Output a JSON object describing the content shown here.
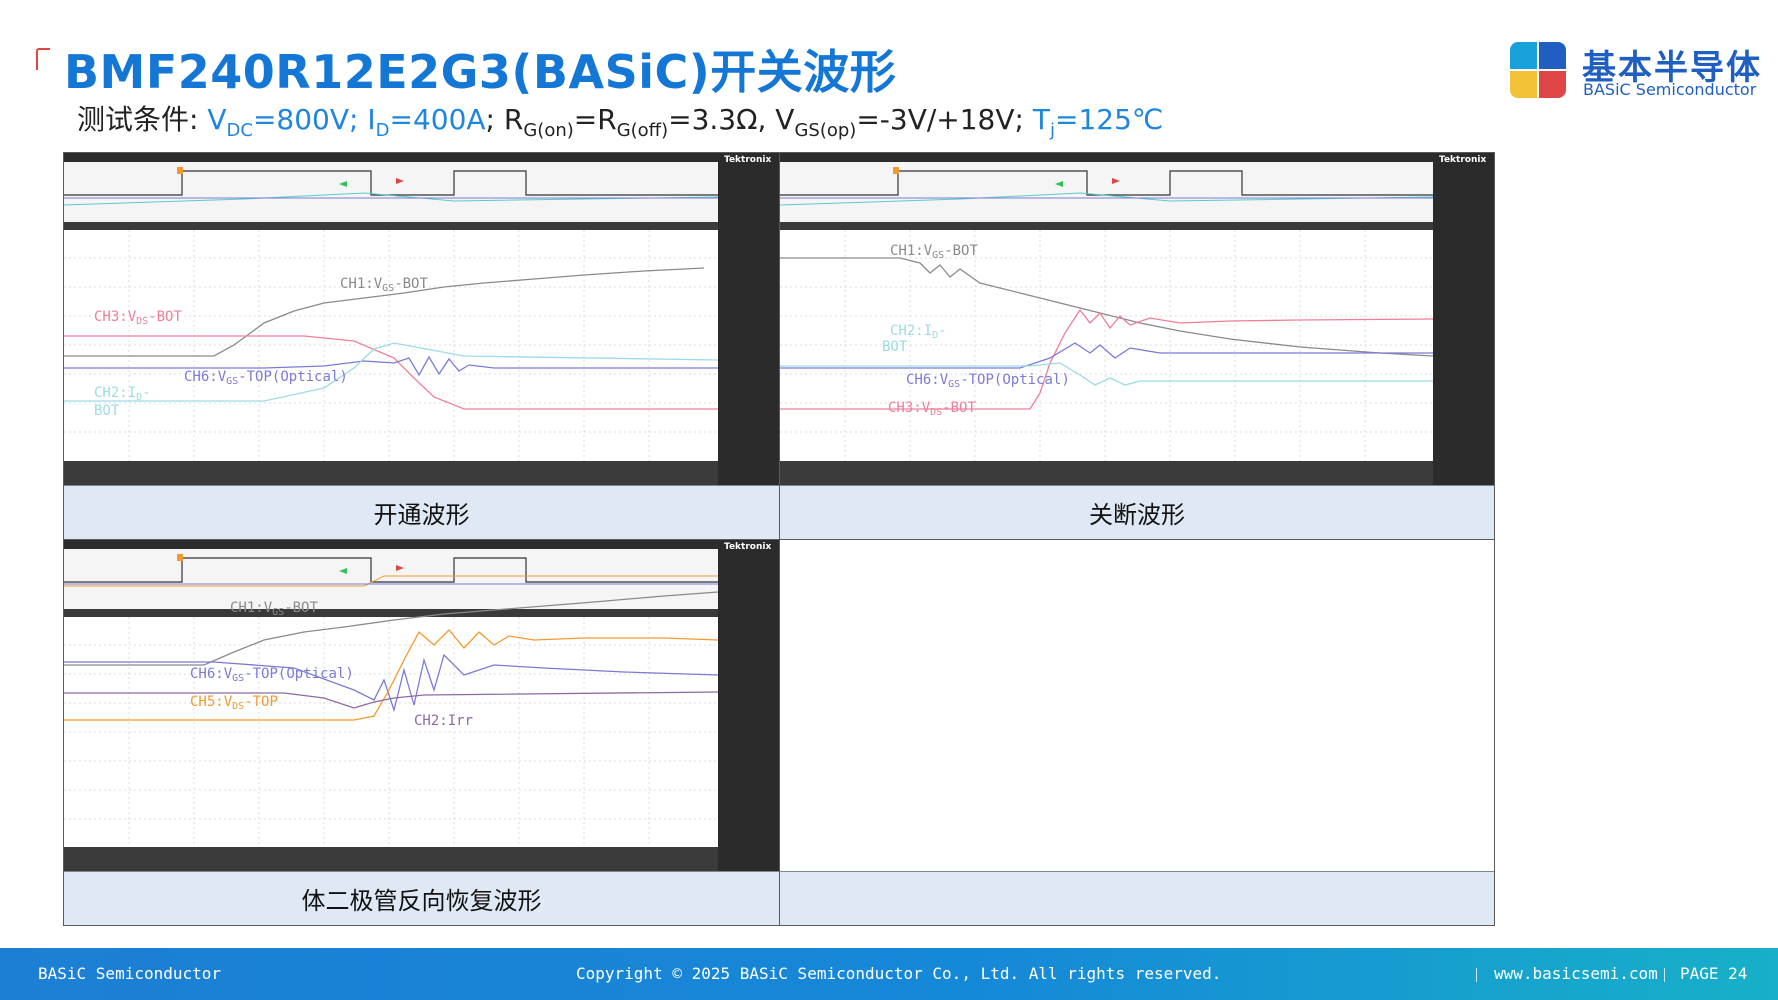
{
  "header": {
    "title": "BMF240R12E2G3(BASiC)开关波形",
    "conditions": {
      "prefix": "测试条件: ",
      "vdc_main": "V",
      "vdc_sub": "DC",
      "vdc_val": "=800V; ",
      "id_main": "I",
      "id_sub": "D",
      "id_val": "=400A",
      "rg_a_main": "; R",
      "rg_a_sub": "G(on)",
      "rg_b_main": "=R",
      "rg_b_sub": "G(off)",
      "rg_val": "=3.3Ω, ",
      "vgs_main": "V",
      "vgs_sub": "GS(op)",
      "vgs_val": "=-3V/+18V; ",
      "tj_main": "T",
      "tj_sub": "j",
      "tj_val": "=125℃"
    }
  },
  "logo": {
    "cn": "基本半导体",
    "en": "BASiC Semiconductor"
  },
  "panels": {
    "turn_on": {
      "caption": "开通波形",
      "brand": "Tektronix",
      "labels": {
        "ch1_a": "CH1:V",
        "ch1_sub": "GS",
        "ch1_b": "-BOT",
        "ch3_a": "CH3:V",
        "ch3_sub": "DS",
        "ch3_b": "-BOT",
        "ch6_a": "CH6:V",
        "ch6_sub": "GS",
        "ch6_b": "-TOP(Optical)",
        "ch2_a": "CH2:I",
        "ch2_sub": "D",
        "ch2_b": "-",
        "ch2_c": "BOT"
      }
    },
    "turn_off": {
      "caption": "关断波形",
      "brand": "Tektronix",
      "labels": {
        "ch1_a": "CH1:V",
        "ch1_sub": "GS",
        "ch1_b": "-BOT",
        "ch2_a": "CH2:I",
        "ch2_sub": "D",
        "ch2_b": "-",
        "ch2_c": "BOT",
        "ch6_a": "CH6:V",
        "ch6_sub": "GS",
        "ch6_b": "-TOP(Optical)",
        "ch3_a": "CH3:V",
        "ch3_sub": "DS",
        "ch3_b": "-BOT"
      }
    },
    "reverse_recovery": {
      "caption": "体二极管反向恢复波形",
      "brand": "Tektronix",
      "labels": {
        "ch1_a": "CH1:V",
        "ch1_sub": "GS",
        "ch1_b": "-BOT",
        "ch6_a": "CH6:V",
        "ch6_sub": "GS",
        "ch6_b": "-TOP(Optical)",
        "ch5_a": "CH5:V",
        "ch5_sub": "DS",
        "ch5_b": "-TOP",
        "ch2": "CH2:Irr"
      }
    }
  },
  "colors": {
    "ch1": "#8a8a8a",
    "ch2": "#9ddbe6",
    "ch3": "#ef7f96",
    "ch5": "#f29a2e",
    "ch6": "#7b7bd6",
    "ch2_irr": "#8d6aa6"
  },
  "footer": {
    "company": "BASiC Semiconductor",
    "copyright": "Copyright © 2025 BASiC Semiconductor Co., Ltd. All rights reserved.",
    "website": "www.basicsemi.com",
    "page": "PAGE 24"
  }
}
